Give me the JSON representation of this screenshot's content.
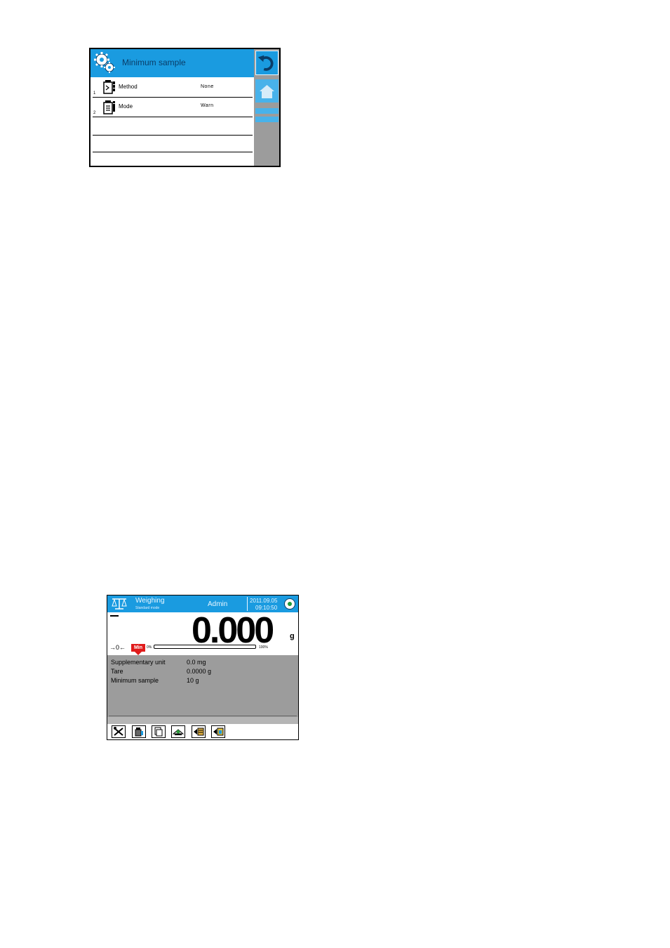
{
  "minimum_sample_screen": {
    "title": "Minimum sample",
    "rows": [
      {
        "number": "1",
        "label": "Method",
        "value": "None"
      },
      {
        "number": "2",
        "label": "Mode",
        "value": "Warn"
      }
    ],
    "icons": {
      "header": "settings-gears-icon",
      "back": "back-arrow-icon",
      "home": "home-icon",
      "row": "weight-bottle-icon"
    }
  },
  "weighing_screen": {
    "title": "Weighing",
    "mode": "Standard mode",
    "user": "Admin",
    "date": "2011.09.05",
    "time": "09:10:50",
    "weight_value": "0.000",
    "weight_unit": "g",
    "zero_indicator": "→0←",
    "min_badge": "Min",
    "bargraph_start": "0%",
    "bargraph_end": "100%",
    "bargraph_level": 0,
    "info": [
      {
        "label": "Supplementary unit",
        "value": "0.0 mg"
      },
      {
        "label": "Tare",
        "value": "0.0000 g"
      },
      {
        "label": "Minimum sample",
        "value": "10 g"
      }
    ],
    "toolbar_icons": [
      "tools-icon",
      "weight-icon",
      "printer-icon",
      "balance-icon",
      "database-icon",
      "report-icon"
    ],
    "colors": {
      "accent": "#1a9be0",
      "panel": "#9c9c9c",
      "min_badge": "#e01b1b",
      "status": "#1f9a3a"
    }
  }
}
